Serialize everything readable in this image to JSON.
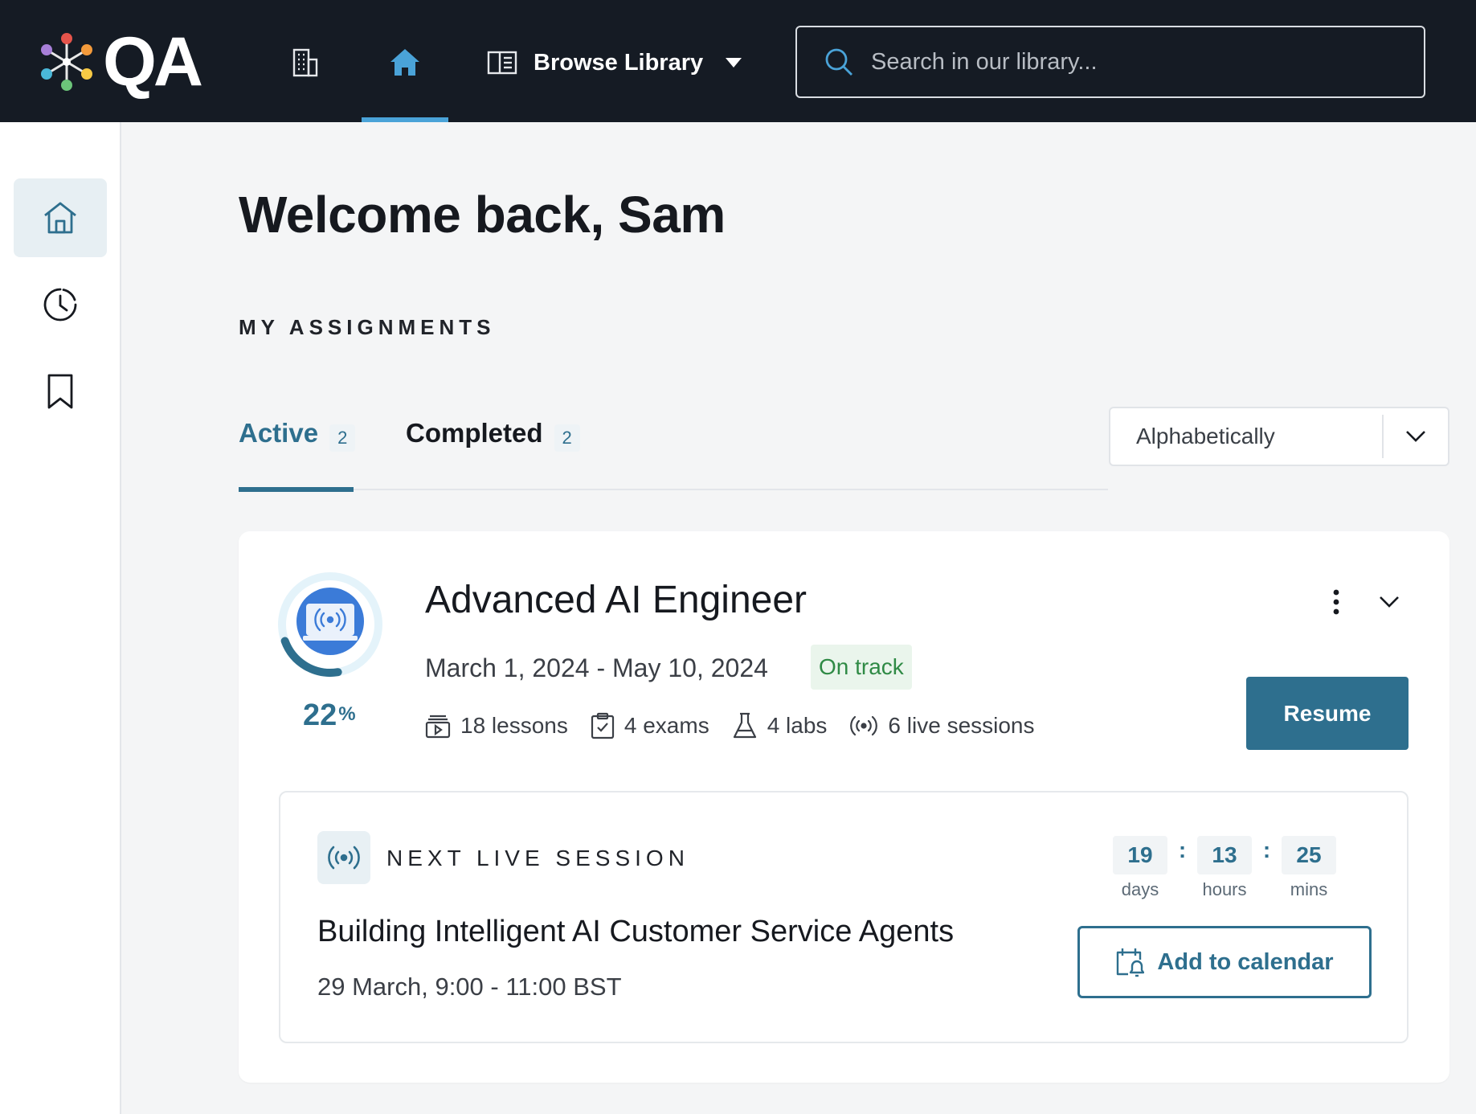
{
  "topbar": {
    "logo_text": "QA",
    "browse_label": "Browse Library",
    "search_placeholder": "Search in our library...",
    "accent_color": "#4aa3d8",
    "background_color": "#151b24",
    "icons": [
      "building-icon",
      "home-icon",
      "book-icon",
      "caret-down-icon",
      "search-icon"
    ]
  },
  "sidebar": {
    "items": [
      {
        "name": "home",
        "icon": "home-outline-icon",
        "active": true
      },
      {
        "name": "history",
        "icon": "history-icon",
        "active": false
      },
      {
        "name": "bookmarks",
        "icon": "bookmark-icon",
        "active": false
      }
    ]
  },
  "main": {
    "welcome": "Welcome back, Sam",
    "section_title": "MY ASSIGNMENTS",
    "tabs": [
      {
        "label": "Active",
        "count": "2",
        "active": true
      },
      {
        "label": "Completed",
        "count": "2",
        "active": false
      }
    ],
    "sort": {
      "selected": "Alphabetically"
    }
  },
  "assignment": {
    "title": "Advanced AI Engineer",
    "dates": "March 1, 2024 - May 10, 2024",
    "status": "On track",
    "progress_value": "22",
    "progress_sign": "%",
    "progress_fraction": 0.22,
    "meta": {
      "lessons": "18 lessons",
      "exams": "4 exams",
      "labs": "4 labs",
      "live_sessions": "6 live sessions"
    },
    "resume_label": "Resume",
    "primary_color": "#2e6f8e",
    "status_color": "#2f8a45"
  },
  "live_session": {
    "label": "NEXT LIVE SESSION",
    "title": "Building Intelligent AI Customer Service Agents",
    "time": "29 March, 9:00 - 11:00 BST",
    "countdown": {
      "days": "19",
      "days_label": "days",
      "hours": "13",
      "hours_label": "hours",
      "mins": "25",
      "mins_label": "mins",
      "separator": ":"
    },
    "calendar_label": "Add to calendar"
  }
}
